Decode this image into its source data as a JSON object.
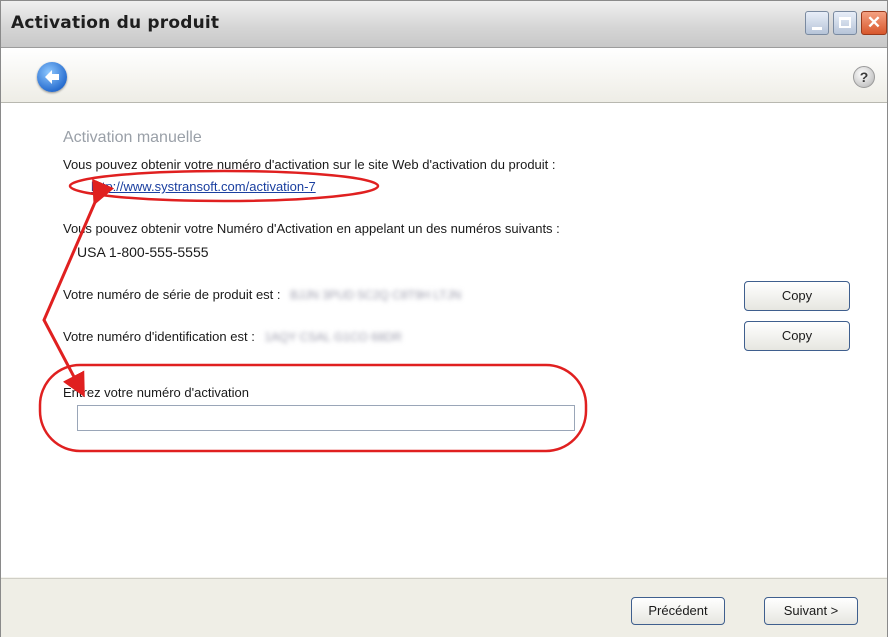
{
  "window": {
    "title": "Activation du produit",
    "controls": {
      "minimize": "minimize",
      "maximize": "maximize",
      "close": "close"
    }
  },
  "nav": {
    "help_label": "?"
  },
  "content": {
    "section_title": "Activation manuelle",
    "web_intro": "Vous pouvez obtenir votre numéro d'activation sur le site Web d'activation du produit :",
    "activation_url": "http://www.systransoft.com/activation-7",
    "phone_intro": "Vous pouvez obtenir votre Numéro d'Activation en appelant un des numéros suivants :",
    "phone_number": "USA  1-800-555-5555",
    "serial_label": "Votre numéro de série de produit est :",
    "serial_value": "BJJN 3PUD 5C2Q C8T9H LTJN",
    "id_label": "Votre numéro d'identification est :",
    "id_value": "1AQY CSAL G1CO 68DR",
    "copy_label": "Copy",
    "activation_field_label": "Entrez votre numéro d'activation",
    "activation_field_value": ""
  },
  "footer": {
    "prev_label": "Précédent",
    "next_label": "Suivant >"
  },
  "colors": {
    "annotation": "#e02020",
    "link": "#1a3fa0",
    "section_title": "#9aa0a8",
    "close_button": "#d8572c"
  }
}
